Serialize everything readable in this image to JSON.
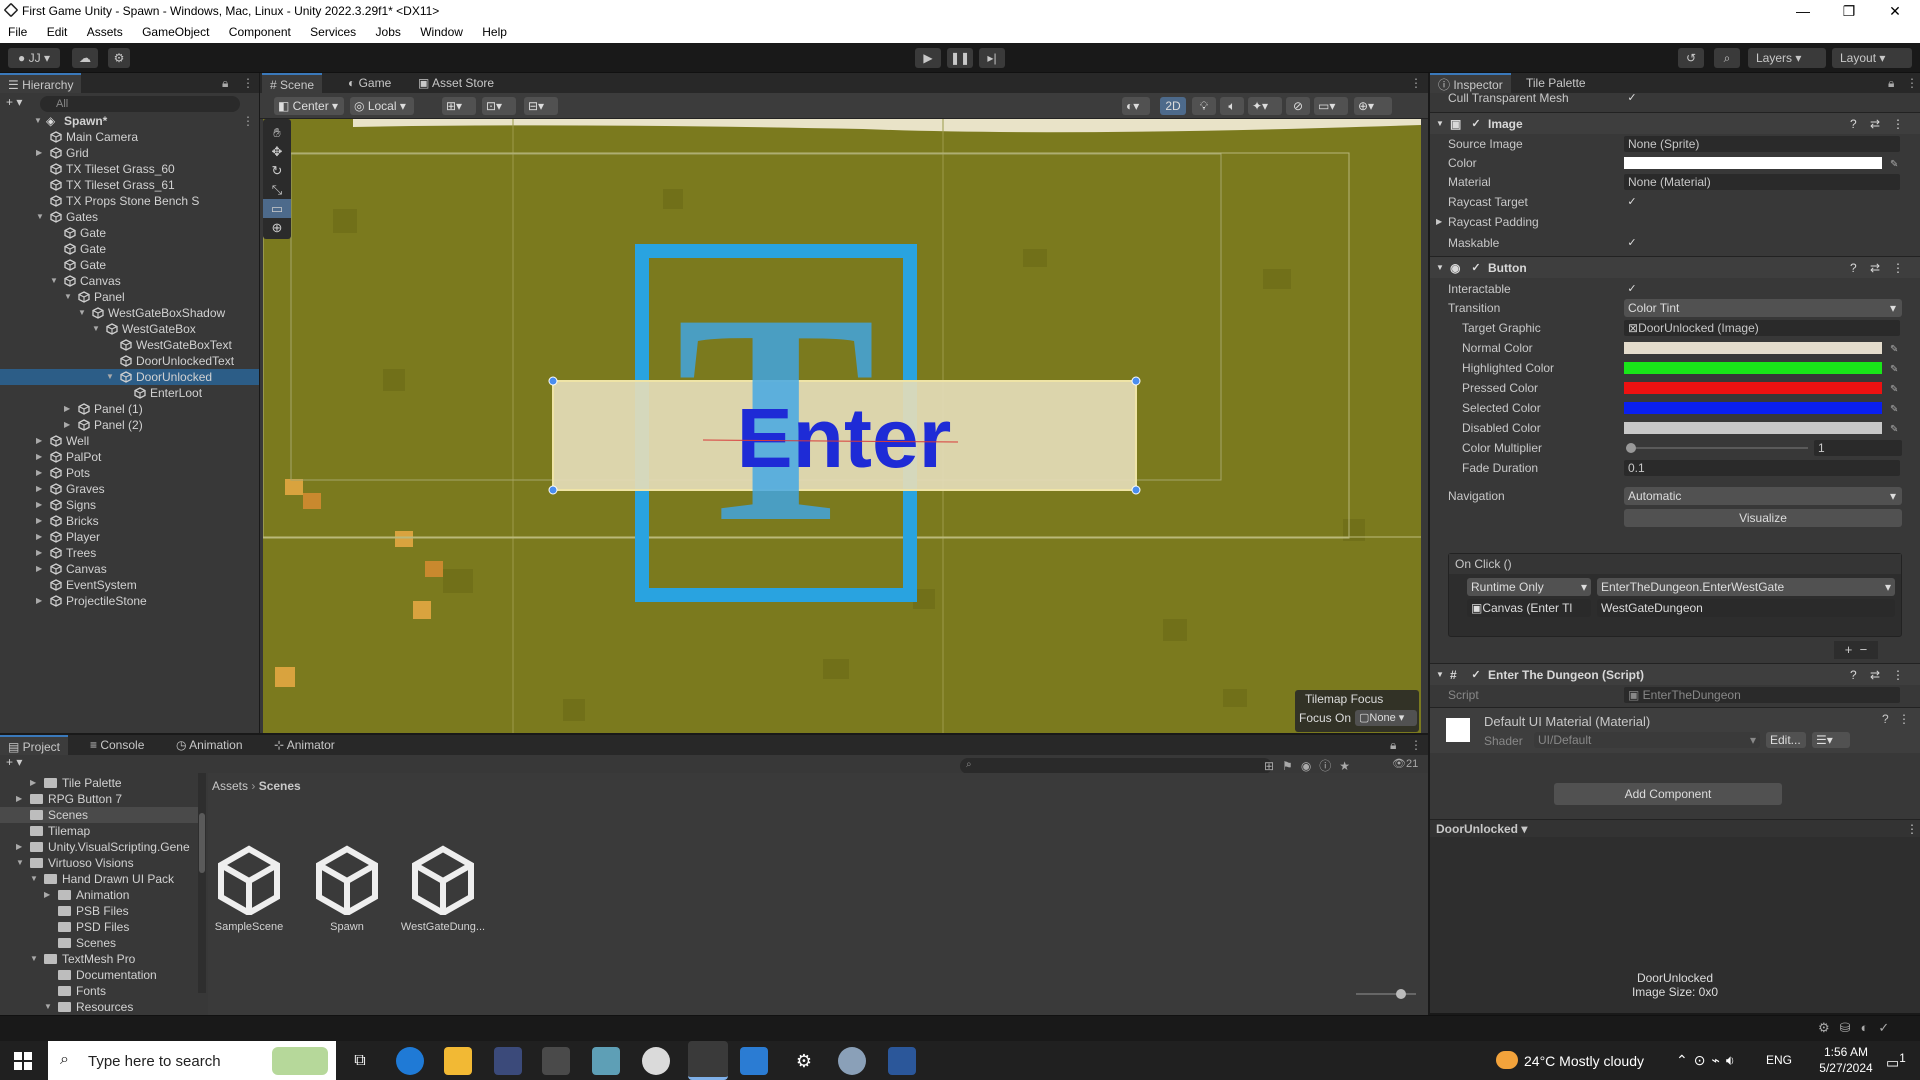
{
  "window": {
    "title": "First Game Unity - Spawn - Windows, Mac, Linux - Unity 2022.3.29f1* <DX11>"
  },
  "menu": [
    "File",
    "Edit",
    "Assets",
    "GameObject",
    "Component",
    "Services",
    "Jobs",
    "Window",
    "Help"
  ],
  "toolbar": {
    "account": "JJ",
    "layers": "Layers",
    "layout": "Layout"
  },
  "hierarchy": {
    "tab": "Hierarchy",
    "search_placeholder": "All",
    "scene": "Spawn*",
    "items": [
      {
        "label": "Main Camera",
        "indent": 1,
        "arrow": "",
        "sel": false
      },
      {
        "label": "Grid",
        "indent": 1,
        "arrow": "▶",
        "sel": false
      },
      {
        "label": "TX Tileset Grass_60",
        "indent": 1,
        "arrow": "",
        "sel": false
      },
      {
        "label": "TX Tileset Grass_61",
        "indent": 1,
        "arrow": "",
        "sel": false
      },
      {
        "label": "TX Props Stone Bench S",
        "indent": 1,
        "arrow": "",
        "sel": false
      },
      {
        "label": "Gates",
        "indent": 1,
        "arrow": "▼",
        "sel": false
      },
      {
        "label": "Gate",
        "indent": 2,
        "arrow": "",
        "sel": false
      },
      {
        "label": "Gate",
        "indent": 2,
        "arrow": "",
        "sel": false
      },
      {
        "label": "Gate",
        "indent": 2,
        "arrow": "",
        "sel": false
      },
      {
        "label": "Canvas",
        "indent": 2,
        "arrow": "▼",
        "sel": false
      },
      {
        "label": "Panel",
        "indent": 3,
        "arrow": "▼",
        "sel": false
      },
      {
        "label": "WestGateBoxShadow",
        "indent": 4,
        "arrow": "▼",
        "sel": false
      },
      {
        "label": "WestGateBox",
        "indent": 5,
        "arrow": "▼",
        "sel": false
      },
      {
        "label": "WestGateBoxText",
        "indent": 6,
        "arrow": "",
        "sel": false
      },
      {
        "label": "DoorUnlockedText",
        "indent": 6,
        "arrow": "",
        "sel": false
      },
      {
        "label": "DoorUnlocked",
        "indent": 6,
        "arrow": "▼",
        "sel": true
      },
      {
        "label": "EnterLoot",
        "indent": 7,
        "arrow": "",
        "sel": false
      },
      {
        "label": "Panel (1)",
        "indent": 3,
        "arrow": "▶",
        "sel": false
      },
      {
        "label": "Panel (2)",
        "indent": 3,
        "arrow": "▶",
        "sel": false
      },
      {
        "label": "Well",
        "indent": 1,
        "arrow": "▶",
        "sel": false
      },
      {
        "label": "PalPot",
        "indent": 1,
        "arrow": "▶",
        "sel": false
      },
      {
        "label": "Pots",
        "indent": 1,
        "arrow": "▶",
        "sel": false
      },
      {
        "label": "Graves",
        "indent": 1,
        "arrow": "▶",
        "sel": false
      },
      {
        "label": "Signs",
        "indent": 1,
        "arrow": "▶",
        "sel": false
      },
      {
        "label": "Bricks",
        "indent": 1,
        "arrow": "▶",
        "sel": false
      },
      {
        "label": "Player",
        "indent": 1,
        "arrow": "▶",
        "sel": false
      },
      {
        "label": "Trees",
        "indent": 1,
        "arrow": "▶",
        "sel": false
      },
      {
        "label": "Canvas",
        "indent": 1,
        "arrow": "▶",
        "sel": false
      },
      {
        "label": "EventSystem",
        "indent": 1,
        "arrow": "",
        "sel": false
      },
      {
        "label": "ProjectileStone",
        "indent": 1,
        "arrow": "▶",
        "sel": false
      }
    ]
  },
  "scene": {
    "tabs": [
      "Scene",
      "Game",
      "Asset Store"
    ],
    "pivot": "Center",
    "space": "Local",
    "mode2d": "2D",
    "enter_text": "Enter",
    "letter": "T",
    "tilemap_focus": "Tilemap Focus",
    "focus_on": "Focus On",
    "focus_value": "None"
  },
  "inspector": {
    "tabs": [
      "Inspector",
      "Tile Palette"
    ],
    "cull": "Cull Transparent Mesh",
    "image": {
      "title": "Image",
      "source_image_k": "Source Image",
      "source_image_v": "None (Sprite)",
      "color_k": "Color",
      "material_k": "Material",
      "material_v": "None (Material)",
      "raycast_k": "Raycast Target",
      "padding_k": "Raycast Padding",
      "maskable_k": "Maskable"
    },
    "button": {
      "title": "Button",
      "interactable_k": "Interactable",
      "transition_k": "Transition",
      "transition_v": "Color Tint",
      "target_k": "Target Graphic",
      "target_v": "DoorUnlocked (Image)",
      "colors": [
        {
          "k": "Normal Color",
          "c": "#e4dccc"
        },
        {
          "k": "Highlighted Color",
          "c": "#19e619"
        },
        {
          "k": "Pressed Color",
          "c": "#ee1111"
        },
        {
          "k": "Selected Color",
          "c": "#0a1ff0"
        },
        {
          "k": "Disabled Color",
          "c": "#c8c8c8"
        }
      ],
      "multiplier_k": "Color Multiplier",
      "multiplier_v": "1",
      "fade_k": "Fade Duration",
      "fade_v": "0.1",
      "nav_k": "Navigation",
      "nav_v": "Automatic",
      "visualize": "Visualize",
      "onclick": "On Click ()",
      "runtime": "Runtime Only",
      "func": "EnterTheDungeon.EnterWestGate",
      "obj": "Canvas (Enter Tl",
      "arg": "WestGateDungeon"
    },
    "script": {
      "title": "Enter The Dungeon (Script)",
      "script_k": "Script",
      "script_v": "EnterTheDungeon"
    },
    "material": {
      "title": "Default UI Material (Material)",
      "shader_k": "Shader",
      "shader_v": "UI/Default",
      "edit": "Edit..."
    },
    "add_component": "Add Component",
    "preview": {
      "name": "DoorUnlocked",
      "caption": "DoorUnlocked",
      "size": "Image Size: 0x0"
    }
  },
  "project": {
    "tabs": [
      "Project",
      "Console",
      "Animation",
      "Animator"
    ],
    "breadcrumb": [
      "Assets",
      "Scenes"
    ],
    "count": "21",
    "tree": [
      {
        "label": "Tile Palette",
        "indent": 2,
        "arrow": "▶"
      },
      {
        "label": "RPG Button 7",
        "indent": 1,
        "arrow": "▶"
      },
      {
        "label": "Scenes",
        "indent": 1,
        "arrow": "",
        "sel": true
      },
      {
        "label": "Tilemap",
        "indent": 1,
        "arrow": ""
      },
      {
        "label": "Unity.VisualScripting.Gene",
        "indent": 1,
        "arrow": "▶"
      },
      {
        "label": "Virtuoso Visions",
        "indent": 1,
        "arrow": "▼"
      },
      {
        "label": "Hand Drawn UI Pack",
        "indent": 2,
        "arrow": "▼"
      },
      {
        "label": "Animation",
        "indent": 3,
        "arrow": "▶"
      },
      {
        "label": "PSB Files",
        "indent": 3,
        "arrow": ""
      },
      {
        "label": "PSD Files",
        "indent": 3,
        "arrow": ""
      },
      {
        "label": "Scenes",
        "indent": 3,
        "arrow": ""
      },
      {
        "label": "TextMesh Pro",
        "indent": 2,
        "arrow": "▼"
      },
      {
        "label": "Documentation",
        "indent": 3,
        "arrow": ""
      },
      {
        "label": "Fonts",
        "indent": 3,
        "arrow": ""
      },
      {
        "label": "Resources",
        "indent": 3,
        "arrow": "▼"
      }
    ],
    "assets": [
      "SampleScene",
      "Spawn",
      "WestGateDung..."
    ]
  },
  "taskbar": {
    "search_placeholder": "Type here to search",
    "weather": "24°C  Mostly cloudy",
    "lang": "ENG",
    "time": "1:56 AM",
    "date": "5/27/2024",
    "notif": "1"
  }
}
